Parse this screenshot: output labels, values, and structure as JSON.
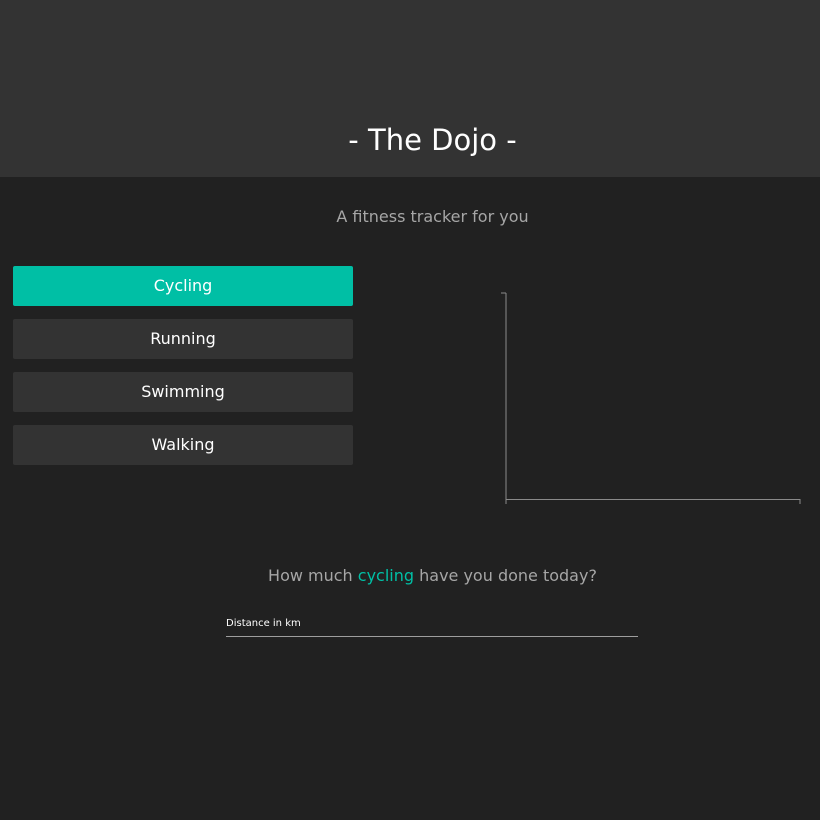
{
  "header": {
    "title": "- The Dojo -"
  },
  "subtitle": "A fitness tracker for you",
  "activities": [
    {
      "label": "Cycling",
      "active": true
    },
    {
      "label": "Running",
      "active": false
    },
    {
      "label": "Swimming",
      "active": false
    },
    {
      "label": "Walking",
      "active": false
    }
  ],
  "question": {
    "prefix": "How much ",
    "activity": "cycling",
    "suffix": " have you done today?"
  },
  "distance_input": {
    "placeholder": "Distance in km",
    "value": ""
  },
  "colors": {
    "accent": "#00bfa5",
    "header_bg": "#333333",
    "page_bg": "#212121",
    "muted_text": "#a6a6a6"
  }
}
